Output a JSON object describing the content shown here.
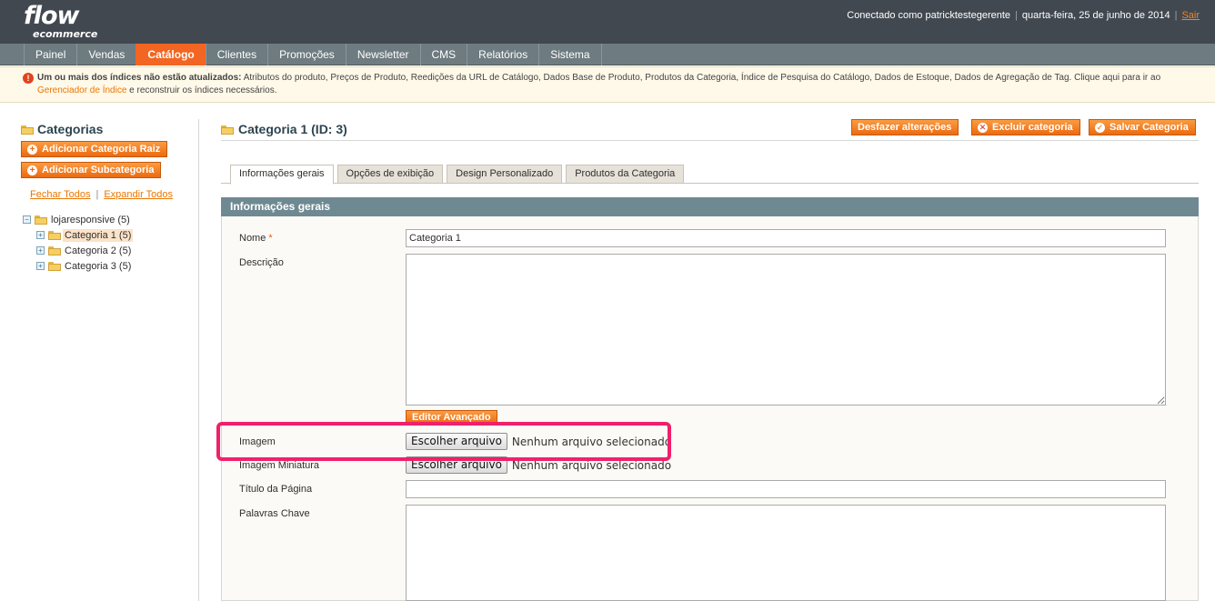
{
  "app": {
    "logo_main": "flow",
    "logo_sub": "ecommerce"
  },
  "header": {
    "user_text": "Conectado como patricktestegerente",
    "date_text": "quarta-feira, 25 de junho de 2014",
    "logout_label": "Sair"
  },
  "nav": {
    "items": [
      "Painel",
      "Vendas",
      "Catálogo",
      "Clientes",
      "Promoções",
      "Newsletter",
      "CMS",
      "Relatórios",
      "Sistema"
    ],
    "active": "Catálogo"
  },
  "notice": {
    "bold_text": "Um ou mais dos índices não estão atualizados:",
    "text_before_link": " Atributos do produto, Preços de Produto, Reedições da URL de Catálogo, Dados Base de Produto, Produtos da Categoria, Índice de Pesquisa do Catálogo, Dados de Estoque, Dados de Agregação de Tag. Clique aqui para ir ao ",
    "link_text": "Gerenciador de Índice",
    "text_after_link": " e reconstruir os índices necessários."
  },
  "sidebar": {
    "title": "Categorias",
    "add_root_label": "Adicionar Categoria Raiz",
    "add_sub_label": "Adicionar Subcategoria",
    "collapse_all": "Fechar Todos",
    "expand_all": "Expandir Todos",
    "tree": {
      "root": "lojaresponsive (5)",
      "children": [
        "Categoria 1 (5)",
        "Categoria 2 (5)",
        "Categoria 3 (5)"
      ],
      "selected": "Categoria 1 (5)"
    }
  },
  "main": {
    "title": "Categoria 1 (ID: 3)",
    "actions": {
      "reset": "Desfazer alterações",
      "delete": "Excluir categoria",
      "save": "Salvar Categoria"
    },
    "tabs": [
      "Informações gerais",
      "Opções de exibição",
      "Design Personalizado",
      "Produtos da Categoria"
    ],
    "active_tab": "Informações gerais",
    "section_title": "Informações gerais",
    "form": {
      "name_label": "Nome",
      "name_required": "*",
      "name_value": "Categoria 1",
      "description_label": "Descrição",
      "description_value": "",
      "editor_button": "Editor Avançado",
      "image_label": "Imagem",
      "thumbnail_label": "Imagem Miniatura",
      "file_button": "Escolher arquivo",
      "no_file_text": "Nenhum arquivo selecionado",
      "page_title_label": "Título da Página",
      "page_title_value": "",
      "keywords_label": "Palavras Chave",
      "keywords_value": ""
    }
  },
  "colors": {
    "accent": "#f26522",
    "header_bg": "#424850",
    "nav_bg": "#6e7b80",
    "section_head": "#6f8992",
    "highlight": "#f0206a"
  }
}
